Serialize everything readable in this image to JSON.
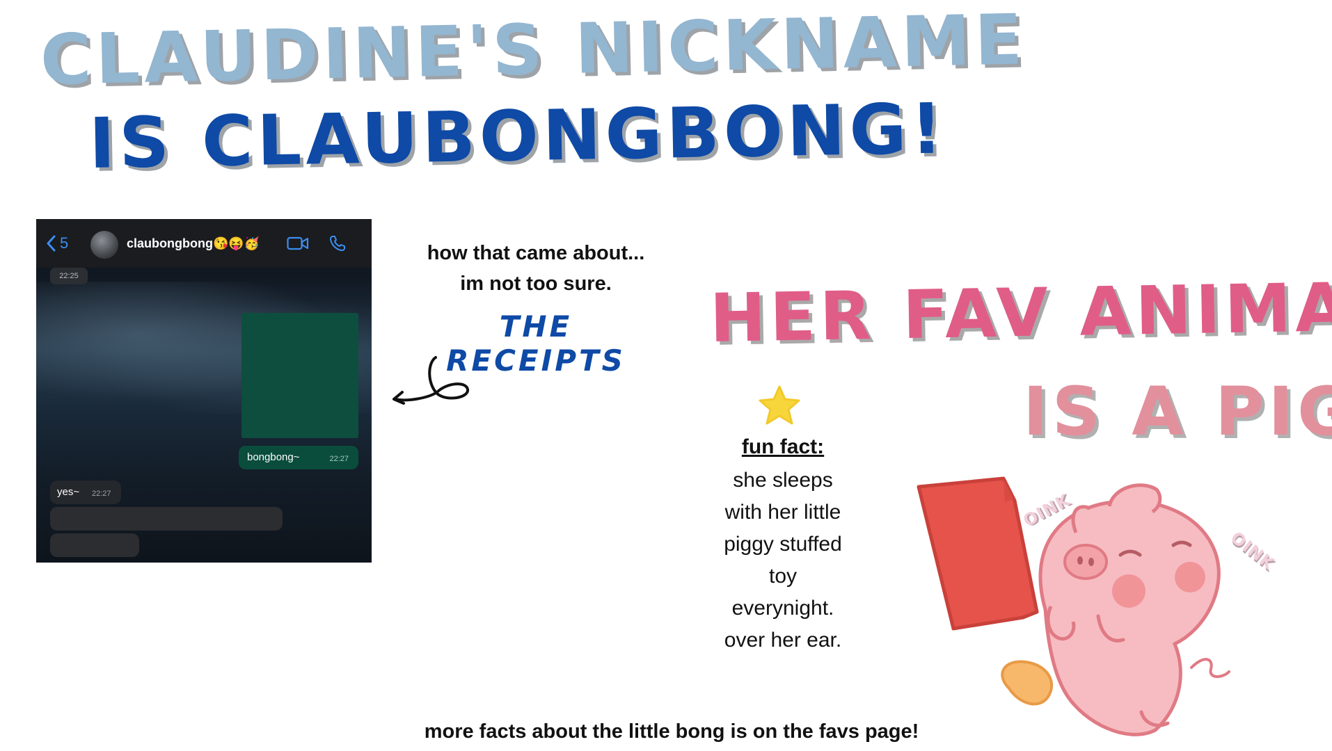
{
  "titles": {
    "line1": "CLAUDINE'S NICKNAME",
    "line2": "IS CLAUBONGBONG!",
    "line3": "HER FAV ANIMAL",
    "line4": "IS A PIG."
  },
  "chat": {
    "back_count": "5",
    "contact_name": "claubongbong😘😝🥳",
    "timestamp_top": "22:25",
    "sent_message": "bongbong~",
    "sent_time": "22:27",
    "reply_message": "yes~",
    "reply_time": "22:27"
  },
  "notes": {
    "about_line1": "how that came about...",
    "about_line2": "im not too sure.",
    "receipts": "THE RECEIPTS"
  },
  "fun_fact": {
    "title": "fun fact:",
    "lines": [
      "she sleeps",
      "with her little",
      "piggy stuffed",
      "toy",
      "everynight.",
      "over her ear."
    ]
  },
  "pig": {
    "oink1": "OINK",
    "oink2": "OINK"
  },
  "footer": "more facts about the little bong is on the favs page!",
  "colors": {
    "light_blue": "#93b6d1",
    "dark_blue": "#0e4aa6",
    "pink": "#e05d88",
    "light_pink": "#e2909c",
    "chat_green": "#0a4d3d",
    "star_yellow": "#f7d63c",
    "sign_red": "#e5534b"
  },
  "icons": [
    "back-chevron-icon",
    "video-call-icon",
    "phone-call-icon",
    "star-icon",
    "curly-arrow-icon"
  ]
}
